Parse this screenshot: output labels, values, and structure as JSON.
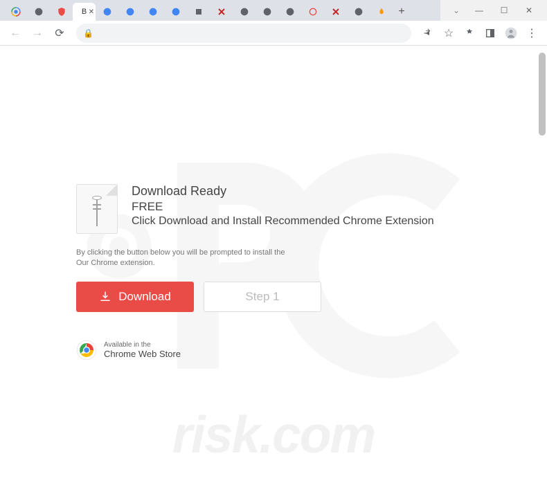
{
  "window": {
    "tabs": [
      {
        "type": "google"
      },
      {
        "type": "globe"
      },
      {
        "type": "shield"
      },
      {
        "type": "active",
        "label": "B"
      },
      {
        "type": "google"
      },
      {
        "type": "google"
      },
      {
        "type": "google"
      },
      {
        "type": "google"
      },
      {
        "type": "anchor"
      },
      {
        "type": "redx"
      },
      {
        "type": "globe"
      },
      {
        "type": "globe"
      },
      {
        "type": "globe"
      },
      {
        "type": "redo"
      },
      {
        "type": "redx"
      },
      {
        "type": "globe"
      },
      {
        "type": "flame"
      }
    ]
  },
  "content": {
    "heading": "Download Ready",
    "free_label": "FREE",
    "subtitle": "Click Download and Install Recommended Chrome Extension",
    "disclaimer_line1": "By clicking the button below you will be prompted to install the",
    "disclaimer_line2": "Our Chrome extension.",
    "download_btn": "Download",
    "step_btn": "Step 1",
    "store_avail": "Available in the",
    "store_name": "Chrome Web Store"
  },
  "watermark": {
    "top": "pc",
    "bottom": "risk.com"
  }
}
